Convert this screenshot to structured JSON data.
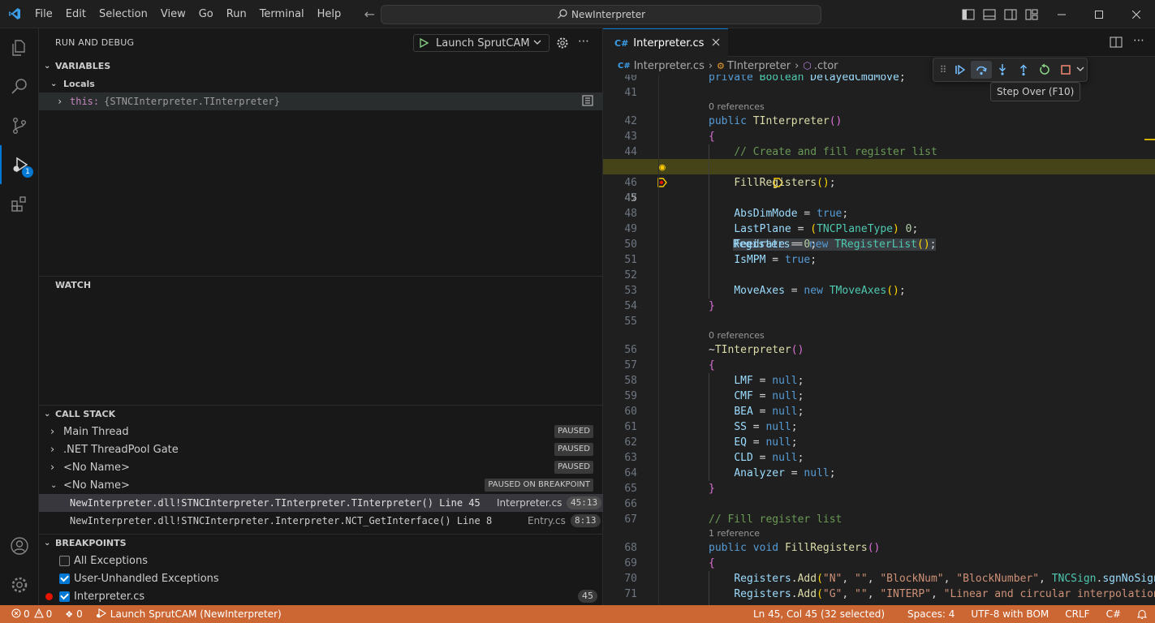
{
  "titlebar": {
    "menu": [
      "File",
      "Edit",
      "Selection",
      "View",
      "Go",
      "Run",
      "Terminal",
      "Help"
    ],
    "search_text": "NewInterpreter"
  },
  "activity": {
    "debug_badge": "1"
  },
  "sidebar": {
    "title": "RUN AND DEBUG",
    "launch_config": "Launch SprutCAM",
    "variables": {
      "header": "VARIABLES",
      "scope": "Locals",
      "item_name": "this:",
      "item_value": "{STNCInterpreter.TInterpreter}"
    },
    "watch": {
      "header": "WATCH"
    },
    "call_stack": {
      "header": "CALL STACK",
      "threads": [
        {
          "name": "Main Thread",
          "state": "PAUSED"
        },
        {
          "name": ".NET ThreadPool Gate",
          "state": "PAUSED"
        },
        {
          "name": "<No Name>",
          "state": "PAUSED"
        },
        {
          "name": "<No Name>",
          "state": "PAUSED ON BREAKPOINT"
        }
      ],
      "frames": [
        {
          "name": "NewInterpreter.dll!STNCInterpreter.TInterpreter.TInterpreter() Line 45",
          "file": "Interpreter.cs",
          "pos": "45:13"
        },
        {
          "name": "NewInterpreter.dll!STNCInterpreter.Interpreter.NCT_GetInterface() Line 8",
          "file": "Entry.cs",
          "pos": "8:13"
        }
      ]
    },
    "breakpoints": {
      "header": "BREAKPOINTS",
      "items": [
        {
          "label": "All Exceptions",
          "checked": false
        },
        {
          "label": "User-Unhandled Exceptions",
          "checked": true
        },
        {
          "label": "Interpreter.cs",
          "checked": true,
          "line": "45"
        }
      ]
    }
  },
  "editor": {
    "tab": "Interpreter.cs",
    "breadcrumb": [
      "Interpreter.cs",
      "TInterpreter",
      ".ctor"
    ],
    "tooltip": "Step Over (F10)",
    "codelens": {
      "zero": "0 references",
      "one": "1 reference"
    },
    "line_numbers": [
      "40",
      "41",
      "42",
      "43",
      "44",
      "45",
      "46",
      "47",
      "48",
      "49",
      "50",
      "51",
      "52",
      "53",
      "54",
      "55",
      "56",
      "57",
      "58",
      "59",
      "60",
      "61",
      "62",
      "63",
      "64",
      "65",
      "66",
      "67",
      "68",
      "69",
      "70",
      "71"
    ]
  },
  "status": {
    "errors": "0",
    "warnings": "0",
    "ports": "0",
    "launch": "Launch SprutCAM (NewInterpreter)",
    "position": "Ln 45, Col 45 (32 selected)",
    "spaces": "Spaces: 4",
    "encoding": "UTF-8 with BOM",
    "eol": "CRLF",
    "language": "C#"
  },
  "colors": {
    "accent": "#0078d4",
    "statusbar": "#cc6633",
    "current_line": "#4b4b18",
    "breakpoint": "#e51400"
  }
}
